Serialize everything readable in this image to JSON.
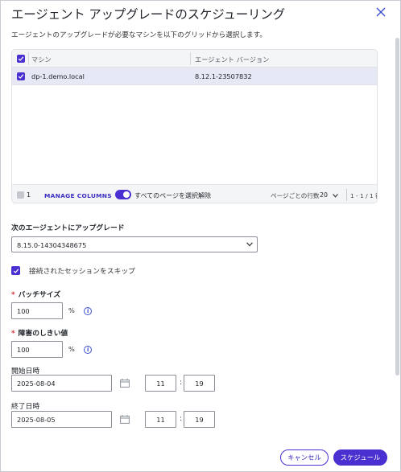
{
  "dialog": {
    "title": "エージェント アップグレードのスケジューリング",
    "subtitle": "エージェントのアップグレードが必要なマシンを以下のグリッドから選択します。"
  },
  "grid": {
    "columns": [
      "マシン",
      "エージェント バージョン"
    ],
    "rows": [
      {
        "machine": "dp-1.demo.local",
        "version": "8.12.1-23507832",
        "selected": true
      }
    ],
    "footer": {
      "selected_count": "1",
      "manage_columns": "MANAGE COLUMNS",
      "toggle_label": "すべてのページを選択解除",
      "toggle_on": true,
      "rows_per_page_label": "ページごとの行数",
      "rows_per_page": "20",
      "range": "1 - 1 / 1 行"
    }
  },
  "form": {
    "upgrade_to_label": "次のエージェントにアップグレード",
    "upgrade_to_value": "8.15.0-14304348675",
    "skip_sessions_label": "接続されたセッションをスキップ",
    "skip_sessions_checked": true,
    "batch_size_label": "バッチサイズ",
    "batch_size_value": "100",
    "batch_size_unit": "%",
    "failure_threshold_label": "障害のしきい値",
    "failure_threshold_value": "100",
    "failure_threshold_unit": "%",
    "start_label": "開始日時",
    "start_date": "2025-08-04",
    "start_hour": "11",
    "start_minute": "19",
    "end_label": "終了日時",
    "end_date": "2025-08-05",
    "end_hour": "11",
    "end_minute": "19",
    "time_separator": ":"
  },
  "buttons": {
    "cancel": "キャンセル",
    "schedule": "スケジュール"
  },
  "colors": {
    "accent": "#4a2fd1",
    "required": "#d0313b",
    "selected_row": "#e6e8f5"
  },
  "icons": [
    "close-icon",
    "checkbox-checked-icon",
    "chevron-down-icon",
    "info-icon",
    "calendar-icon"
  ]
}
